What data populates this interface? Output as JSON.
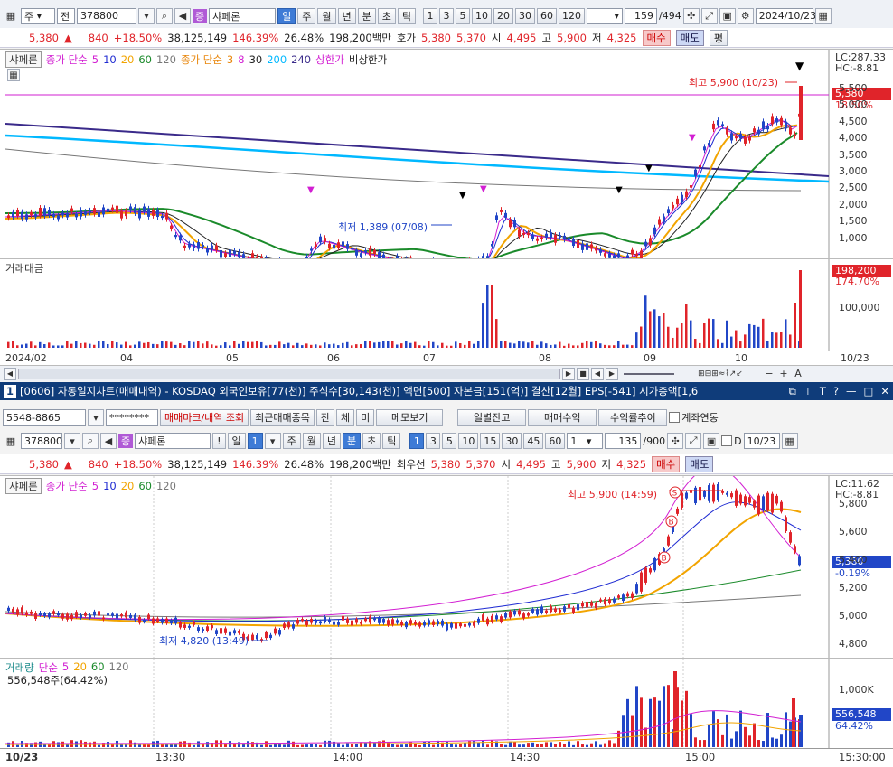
{
  "top_toolbar": {
    "market": "주",
    "prefix": "전",
    "code": "378800",
    "name": "샤페론",
    "periods": [
      "일",
      "주",
      "월",
      "년",
      "분",
      "초",
      "틱"
    ],
    "active_period": "일",
    "nums": [
      "1",
      "3",
      "5",
      "10",
      "20",
      "30",
      "60",
      "120"
    ],
    "count": "159",
    "total": "/494",
    "date": "2024/10/23"
  },
  "quote": {
    "price": "5,380",
    "change": "840",
    "pct": "+18.50%",
    "volume": "38,125,149",
    "vol_ratio": "146.39%",
    "turnover": "26.48%",
    "amount": "198,200백만",
    "ask_label": "호가",
    "ask": "5,380",
    "bid": "5,370",
    "open_label": "시",
    "open": "4,495",
    "high_label": "고",
    "high": "5,900",
    "low_label": "저",
    "low": "4,325",
    "buy": "매수",
    "sell": "매도",
    "eval": "평"
  },
  "daily_chart": {
    "legend": {
      "name": "샤페론",
      "ma_label": "종가 단순",
      "mas": [
        "5",
        "10",
        "20",
        "60",
        "120"
      ],
      "ma2_label": "종가 단순",
      "mas2": [
        "3",
        "8",
        "30",
        "200",
        "240"
      ],
      "upper": "상한가",
      "lower": "비상한가"
    },
    "lc": "LC:287.33",
    "hc": "HC:-8.81",
    "price_box": "5,380",
    "pct_box": "18.50%",
    "axis": [
      "5,500",
      "5,000",
      "4,500",
      "4,000",
      "3,500",
      "3,000",
      "2,500",
      "2,000",
      "1,500",
      "1,000"
    ],
    "high_note": "최고 5,900 (10/23)",
    "low_note": "최저 1,389 (07/08)",
    "volume_legend": "거래대금",
    "vol_box": "198,200",
    "vol_pct": "174.70%",
    "vol_axis": "100,000",
    "xaxis": [
      "2024/02",
      "04",
      "05",
      "06",
      "07",
      "08",
      "09",
      "10"
    ],
    "xaxis_right": "10/23"
  },
  "window_title": "[0606] 자동일지차트(매매내역) - KOSDAQ 외국인보유[77(천)] 주식수[30,143(천)] 액면[500] 자본금[151(억)] 결산[12월] EPS[-541] 시가총액[1,6",
  "account_bar": {
    "account": "5548-8865",
    "password": "********",
    "btn_mark": "매매마크/내역 조회",
    "btn_recent": "최근매매종목",
    "btn_j": "잔",
    "btn_c": "체",
    "btn_m": "미",
    "btn_memo": "메모보기",
    "btn_daily": "일별잔고",
    "btn_profit": "매매수익",
    "btn_rate": "수익률추이",
    "link_label": "계좌연동"
  },
  "intraday_toolbar": {
    "code": "378800",
    "name": "샤페론",
    "periods": [
      "일",
      "1"
    ],
    "kinds": [
      "주",
      "월",
      "년",
      "분",
      "초",
      "틱"
    ],
    "active_kind": "분",
    "nums": [
      "1",
      "3",
      "5",
      "10",
      "15",
      "30",
      "45",
      "60"
    ],
    "sel": "1",
    "count": "135",
    "total": "/900",
    "d_label": "D",
    "date": "10/23"
  },
  "quote2": {
    "price": "5,380",
    "change": "840",
    "pct": "+18.50%",
    "volume": "38,125,149",
    "vol_ratio": "146.39%",
    "turnover": "26.48%",
    "amount": "198,200백만",
    "ask_label": "최우선",
    "ask": "5,380",
    "bid": "5,370",
    "open_label": "시",
    "open": "4,495",
    "high_label": "고",
    "high": "5,900",
    "low_label": "저",
    "low": "4,325",
    "buy": "매수",
    "sell": "매도"
  },
  "intraday_chart": {
    "legend": {
      "name": "샤페론",
      "ma_label": "종가 단순",
      "mas": [
        "5",
        "10",
        "20",
        "60",
        "120"
      ]
    },
    "lc": "LC:11.62",
    "hc": "HC:-8.81",
    "price_box": "5,380",
    "pct_box": "-0.19%",
    "axis": [
      "5,800",
      "5,600",
      "5,400",
      "5,200",
      "5,000",
      "4,800"
    ],
    "high_note": "최고 5,900 (14:59)",
    "low_note": "최저 4,820 (13:49)",
    "volume_legend": "거래량",
    "vol_ma_label": "단순",
    "vol_mas": [
      "5",
      "20",
      "60",
      "120"
    ],
    "vol_value": "556,548주(64.42%)",
    "vol_box": "556,548",
    "vol_pct": "64.42%",
    "vol_axis": "1,000K",
    "xaxis_left": "10/23",
    "xaxis": [
      "13:30",
      "14:00",
      "14:30",
      "15:00"
    ],
    "xaxis_right": "15:30:00"
  },
  "colors": {
    "up": "#e0242a",
    "down": "#2146c7",
    "ma5": "#d21fd2",
    "ma10": "#1f2bd2",
    "ma20": "#f2a400",
    "ma60": "#1a8a2a",
    "ma120": "#777777",
    "ma200": "#00b8ff",
    "ma240": "#3a2a8a",
    "titlebar": "#0f3c7a"
  }
}
